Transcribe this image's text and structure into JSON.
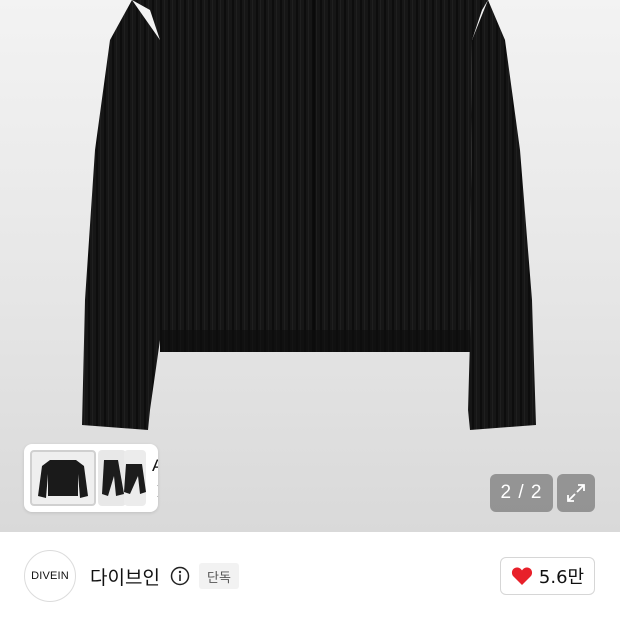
{
  "gallery": {
    "thumbnail_ai_label": "AI",
    "page_counter": "2 / 2"
  },
  "brand": {
    "logo_text": "DIVEIN",
    "name": "다이브인",
    "badge": "단독",
    "likes": "5.6만"
  },
  "colors": {
    "like_heart": "#e8202a",
    "garment": "#151515"
  },
  "icons": {
    "info": "info-circle-icon",
    "expand": "expand-arrows-icon",
    "chevron": "chevron-right-icon",
    "heart": "heart-filled-icon"
  }
}
